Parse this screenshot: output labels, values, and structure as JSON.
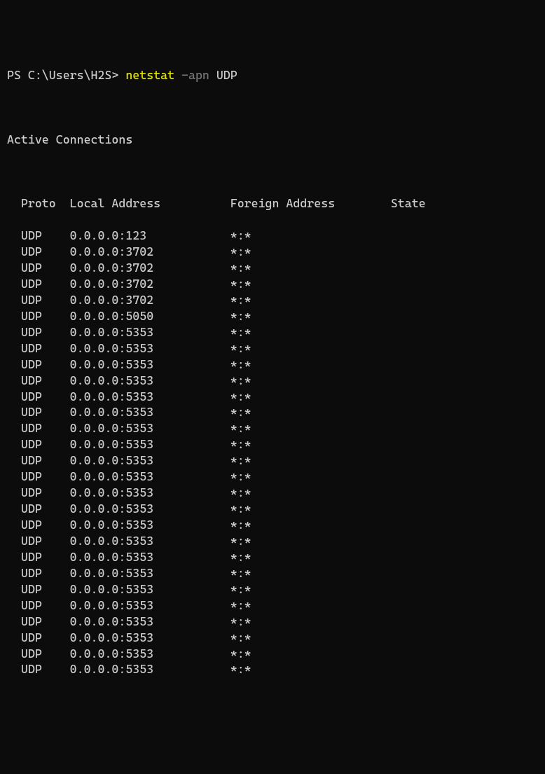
{
  "prompt": {
    "prefix": "PS C:\\Users\\H2S> ",
    "command": "netstat",
    "flag": " -apn ",
    "arg": "UDP"
  },
  "header": "Active Connections",
  "columns": {
    "proto": "Proto",
    "local": "Local Address",
    "foreign": "Foreign Address",
    "state": "State"
  },
  "rows": [
    {
      "proto": "UDP",
      "local": "0.0.0.0:123",
      "foreign": "*:*",
      "state": ""
    },
    {
      "proto": "UDP",
      "local": "0.0.0.0:3702",
      "foreign": "*:*",
      "state": ""
    },
    {
      "proto": "UDP",
      "local": "0.0.0.0:3702",
      "foreign": "*:*",
      "state": ""
    },
    {
      "proto": "UDP",
      "local": "0.0.0.0:3702",
      "foreign": "*:*",
      "state": ""
    },
    {
      "proto": "UDP",
      "local": "0.0.0.0:3702",
      "foreign": "*:*",
      "state": ""
    },
    {
      "proto": "UDP",
      "local": "0.0.0.0:5050",
      "foreign": "*:*",
      "state": ""
    },
    {
      "proto": "UDP",
      "local": "0.0.0.0:5353",
      "foreign": "*:*",
      "state": ""
    },
    {
      "proto": "UDP",
      "local": "0.0.0.0:5353",
      "foreign": "*:*",
      "state": ""
    },
    {
      "proto": "UDP",
      "local": "0.0.0.0:5353",
      "foreign": "*:*",
      "state": ""
    },
    {
      "proto": "UDP",
      "local": "0.0.0.0:5353",
      "foreign": "*:*",
      "state": ""
    },
    {
      "proto": "UDP",
      "local": "0.0.0.0:5353",
      "foreign": "*:*",
      "state": ""
    },
    {
      "proto": "UDP",
      "local": "0.0.0.0:5353",
      "foreign": "*:*",
      "state": ""
    },
    {
      "proto": "UDP",
      "local": "0.0.0.0:5353",
      "foreign": "*:*",
      "state": ""
    },
    {
      "proto": "UDP",
      "local": "0.0.0.0:5353",
      "foreign": "*:*",
      "state": ""
    },
    {
      "proto": "UDP",
      "local": "0.0.0.0:5353",
      "foreign": "*:*",
      "state": ""
    },
    {
      "proto": "UDP",
      "local": "0.0.0.0:5353",
      "foreign": "*:*",
      "state": ""
    },
    {
      "proto": "UDP",
      "local": "0.0.0.0:5353",
      "foreign": "*:*",
      "state": ""
    },
    {
      "proto": "UDP",
      "local": "0.0.0.0:5353",
      "foreign": "*:*",
      "state": ""
    },
    {
      "proto": "UDP",
      "local": "0.0.0.0:5353",
      "foreign": "*:*",
      "state": ""
    },
    {
      "proto": "UDP",
      "local": "0.0.0.0:5353",
      "foreign": "*:*",
      "state": ""
    },
    {
      "proto": "UDP",
      "local": "0.0.0.0:5353",
      "foreign": "*:*",
      "state": ""
    },
    {
      "proto": "UDP",
      "local": "0.0.0.0:5353",
      "foreign": "*:*",
      "state": ""
    },
    {
      "proto": "UDP",
      "local": "0.0.0.0:5353",
      "foreign": "*:*",
      "state": ""
    },
    {
      "proto": "UDP",
      "local": "0.0.0.0:5353",
      "foreign": "*:*",
      "state": ""
    },
    {
      "proto": "UDP",
      "local": "0.0.0.0:5353",
      "foreign": "*:*",
      "state": ""
    },
    {
      "proto": "UDP",
      "local": "0.0.0.0:5353",
      "foreign": "*:*",
      "state": ""
    },
    {
      "proto": "UDP",
      "local": "0.0.0.0:5353",
      "foreign": "*:*",
      "state": ""
    },
    {
      "proto": "UDP",
      "local": "0.0.0.0:5353",
      "foreign": "*:*",
      "state": ""
    }
  ]
}
